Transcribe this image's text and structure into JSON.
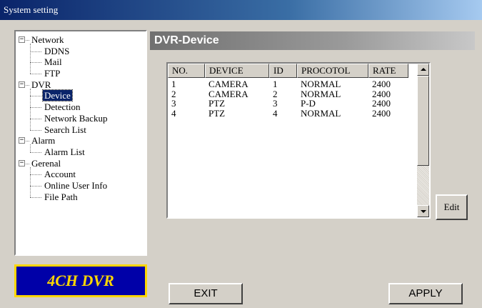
{
  "window": {
    "title": "System setting"
  },
  "tree": [
    {
      "label": "Network",
      "expander": "−",
      "children": [
        "DDNS",
        "Mail",
        "FTP"
      ]
    },
    {
      "label": "DVR",
      "expander": "−",
      "children": [
        "Device",
        "Detection",
        "Network Backup",
        "Search List"
      ],
      "selected_child": "Device"
    },
    {
      "label": "Alarm",
      "expander": "−",
      "children": [
        "Alarm List"
      ]
    },
    {
      "label": "Gerenal",
      "expander": "−",
      "children": [
        "Account",
        "Online User Info",
        "File Path"
      ]
    }
  ],
  "logo": {
    "text": "4CH DVR"
  },
  "section": {
    "title": "DVR-Device"
  },
  "device_table": {
    "columns": [
      "NO.",
      "DEVICE",
      "ID",
      "PROCOTOL",
      "RATE"
    ],
    "rows": [
      [
        "1",
        "CAMERA",
        "1",
        "NORMAL",
        "2400"
      ],
      [
        "2",
        "CAMERA",
        "2",
        "NORMAL",
        "2400"
      ],
      [
        "3",
        "PTZ",
        "3",
        "P-D",
        "2400"
      ],
      [
        "4",
        "PTZ",
        "4",
        "NORMAL",
        "2400"
      ]
    ]
  },
  "buttons": {
    "edit": "Edit",
    "exit": "EXIT",
    "apply": "APPLY"
  },
  "colors": {
    "title_bar": "#0a246a",
    "selection": "#0a246a",
    "logo_bg": "#0000a8",
    "logo_text": "#ffd700",
    "face": "#d4d0c8"
  }
}
